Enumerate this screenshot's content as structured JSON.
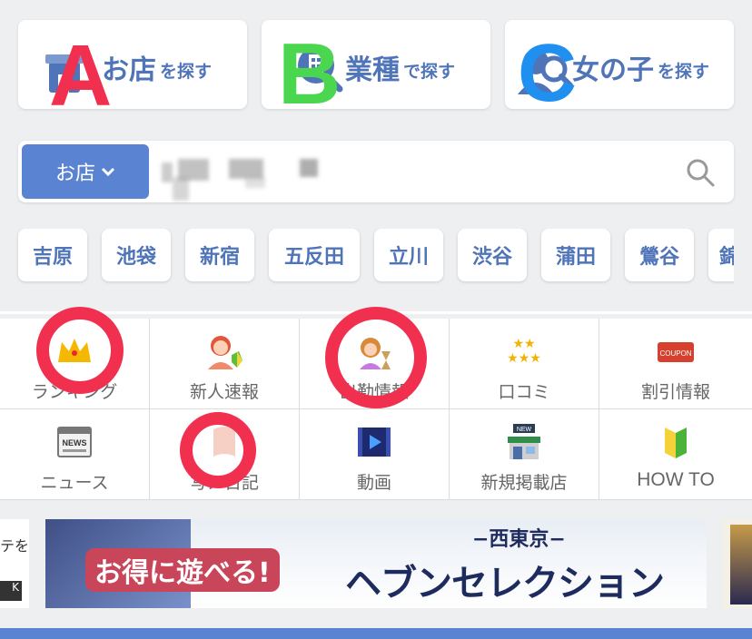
{
  "search_cards": [
    {
      "main": "お店",
      "sub": "を探す",
      "icon": "shop-icon",
      "letter": "A",
      "letter_color": "#f0304e"
    },
    {
      "main": "業種",
      "sub": "で探す",
      "icon": "building-search-icon",
      "letter": "B",
      "letter_color": "#4bd64f"
    },
    {
      "main": "女の子",
      "sub": "を探す",
      "icon": "girl-search-icon",
      "letter": "C",
      "letter_color": "#1f8ff0"
    }
  ],
  "search": {
    "select_label": "お店",
    "select_chevron": "⌄",
    "input_placeholder": ""
  },
  "areas": [
    "吉原",
    "池袋",
    "新宿",
    "五反田",
    "立川",
    "渋谷",
    "蒲田",
    "鶯谷",
    "錦"
  ],
  "menu": [
    {
      "label": "ランキング",
      "icon": "crown-icon"
    },
    {
      "label": "新人速報",
      "icon": "new-girl-icon"
    },
    {
      "label": "出勤情報",
      "icon": "princess-hourglass-icon"
    },
    {
      "label": "口コミ",
      "icon": "stars-icon"
    },
    {
      "label": "割引情報",
      "icon": "coupon-icon"
    },
    {
      "label": "ニュース",
      "icon": "news-icon"
    },
    {
      "label": "写メ日記",
      "icon": "diary-icon"
    },
    {
      "label": "動画",
      "icon": "video-icon"
    },
    {
      "label": "新規掲載店",
      "icon": "new-shop-icon"
    },
    {
      "label": "HOW TO",
      "icon": "beginner-icon"
    }
  ],
  "coupon_text": "COUPON",
  "news_text": "NEWS",
  "new_text": "NEW",
  "banner": {
    "top": "−西東京−",
    "left": "お得に遊べる!",
    "right": "ヘブンセレクション",
    "left_peek": "テを",
    "left_peek_btn": "K"
  },
  "colors": {
    "accent": "#4f74b8",
    "button_blue": "#5a83d1",
    "ring_red": "#f0304e"
  }
}
